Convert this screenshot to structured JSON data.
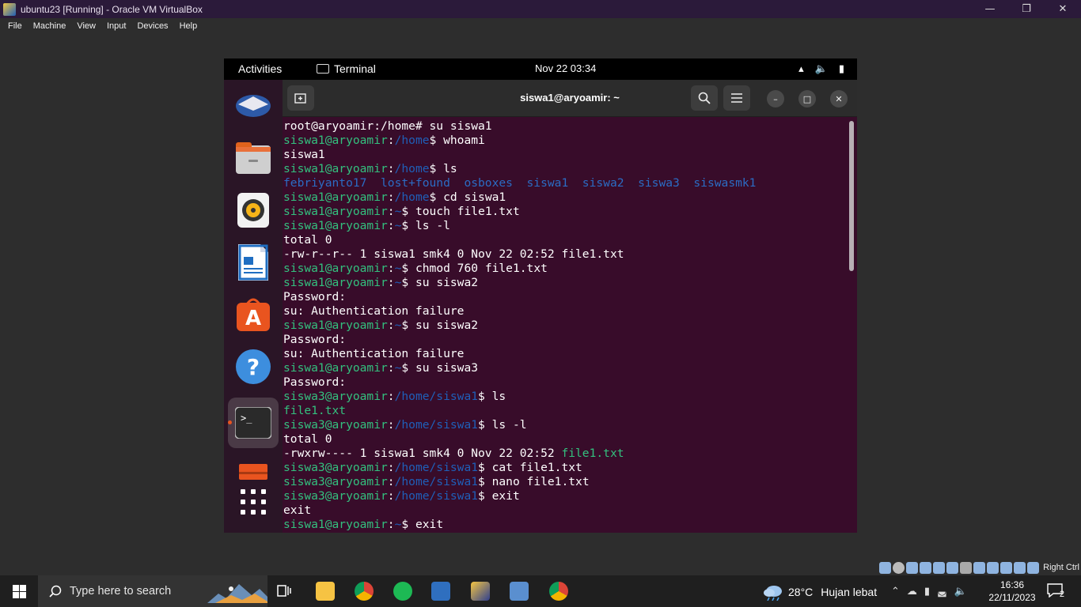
{
  "vbox": {
    "title": "ubuntu23 [Running] - Oracle VM VirtualBox",
    "menu": [
      "File",
      "Machine",
      "View",
      "Input",
      "Devices",
      "Help"
    ],
    "host_key": "Right Ctrl"
  },
  "gnome": {
    "activities": "Activities",
    "app_name": "Terminal",
    "clock": "Nov 22  03:34"
  },
  "terminal": {
    "title": "siswa1@aryoamir: ~",
    "lines": [
      [
        {
          "t": "root@aryoamir:/home# su siswa1",
          "c": ""
        }
      ],
      [
        {
          "t": "siswa1@aryoamir",
          "c": "u"
        },
        {
          "t": ":",
          "c": ""
        },
        {
          "t": "/home",
          "c": "p"
        },
        {
          "t": "$ whoami",
          "c": ""
        }
      ],
      [
        {
          "t": "siswa1",
          "c": ""
        }
      ],
      [
        {
          "t": "siswa1@aryoamir",
          "c": "u"
        },
        {
          "t": ":",
          "c": ""
        },
        {
          "t": "/home",
          "c": "p"
        },
        {
          "t": "$ ls",
          "c": ""
        }
      ],
      [
        {
          "t": "febriyanto17  lost+found  osboxes  siswa1  siswa2  siswa3  siswasmk1",
          "c": "d"
        }
      ],
      [
        {
          "t": "siswa1@aryoamir",
          "c": "u"
        },
        {
          "t": ":",
          "c": ""
        },
        {
          "t": "/home",
          "c": "p"
        },
        {
          "t": "$ cd siswa1",
          "c": ""
        }
      ],
      [
        {
          "t": "siswa1@aryoamir",
          "c": "u"
        },
        {
          "t": ":",
          "c": ""
        },
        {
          "t": "~",
          "c": "p"
        },
        {
          "t": "$ touch file1.txt",
          "c": ""
        }
      ],
      [
        {
          "t": "siswa1@aryoamir",
          "c": "u"
        },
        {
          "t": ":",
          "c": ""
        },
        {
          "t": "~",
          "c": "p"
        },
        {
          "t": "$ ls -l",
          "c": ""
        }
      ],
      [
        {
          "t": "total 0",
          "c": ""
        }
      ],
      [
        {
          "t": "-rw-r--r-- 1 siswa1 smk4 0 Nov 22 02:52 file1.txt",
          "c": ""
        }
      ],
      [
        {
          "t": "siswa1@aryoamir",
          "c": "u"
        },
        {
          "t": ":",
          "c": ""
        },
        {
          "t": "~",
          "c": "p"
        },
        {
          "t": "$ chmod 760 file1.txt",
          "c": ""
        }
      ],
      [
        {
          "t": "siswa1@aryoamir",
          "c": "u"
        },
        {
          "t": ":",
          "c": ""
        },
        {
          "t": "~",
          "c": "p"
        },
        {
          "t": "$ su siswa2",
          "c": ""
        }
      ],
      [
        {
          "t": "Password:",
          "c": ""
        }
      ],
      [
        {
          "t": "su: Authentication failure",
          "c": ""
        }
      ],
      [
        {
          "t": "siswa1@aryoamir",
          "c": "u"
        },
        {
          "t": ":",
          "c": ""
        },
        {
          "t": "~",
          "c": "p"
        },
        {
          "t": "$ su siswa2",
          "c": ""
        }
      ],
      [
        {
          "t": "Password:",
          "c": ""
        }
      ],
      [
        {
          "t": "su: Authentication failure",
          "c": ""
        }
      ],
      [
        {
          "t": "siswa1@aryoamir",
          "c": "u"
        },
        {
          "t": ":",
          "c": ""
        },
        {
          "t": "~",
          "c": "p"
        },
        {
          "t": "$ su siswa3",
          "c": ""
        }
      ],
      [
        {
          "t": "Password:",
          "c": ""
        }
      ],
      [
        {
          "t": "siswa3@aryoamir",
          "c": "u"
        },
        {
          "t": ":",
          "c": ""
        },
        {
          "t": "/home/siswa1",
          "c": "p"
        },
        {
          "t": "$ ls",
          "c": ""
        }
      ],
      [
        {
          "t": "file1.txt",
          "c": "g"
        }
      ],
      [
        {
          "t": "siswa3@aryoamir",
          "c": "u"
        },
        {
          "t": ":",
          "c": ""
        },
        {
          "t": "/home/siswa1",
          "c": "p"
        },
        {
          "t": "$ ls -l",
          "c": ""
        }
      ],
      [
        {
          "t": "total 0",
          "c": ""
        }
      ],
      [
        {
          "t": "-rwxrw---- 1 siswa1 smk4 0 Nov 22 02:52 ",
          "c": ""
        },
        {
          "t": "file1.txt",
          "c": "g"
        }
      ],
      [
        {
          "t": "siswa3@aryoamir",
          "c": "u"
        },
        {
          "t": ":",
          "c": ""
        },
        {
          "t": "/home/siswa1",
          "c": "p"
        },
        {
          "t": "$ cat file1.txt",
          "c": ""
        }
      ],
      [
        {
          "t": "siswa3@aryoamir",
          "c": "u"
        },
        {
          "t": ":",
          "c": ""
        },
        {
          "t": "/home/siswa1",
          "c": "p"
        },
        {
          "t": "$ nano file1.txt",
          "c": ""
        }
      ],
      [
        {
          "t": "siswa3@aryoamir",
          "c": "u"
        },
        {
          "t": ":",
          "c": ""
        },
        {
          "t": "/home/siswa1",
          "c": "p"
        },
        {
          "t": "$ exit",
          "c": ""
        }
      ],
      [
        {
          "t": "exit",
          "c": ""
        }
      ],
      [
        {
          "t": "siswa1@aryoamir",
          "c": "u"
        },
        {
          "t": ":",
          "c": ""
        },
        {
          "t": "~",
          "c": "p"
        },
        {
          "t": "$ exit",
          "c": ""
        }
      ]
    ]
  },
  "taskbar": {
    "search_placeholder": "Type here to search",
    "weather_temp": "28°C",
    "weather_desc": "Hujan lebat",
    "time": "16:36",
    "date": "22/11/2023",
    "notification_count": "2"
  }
}
